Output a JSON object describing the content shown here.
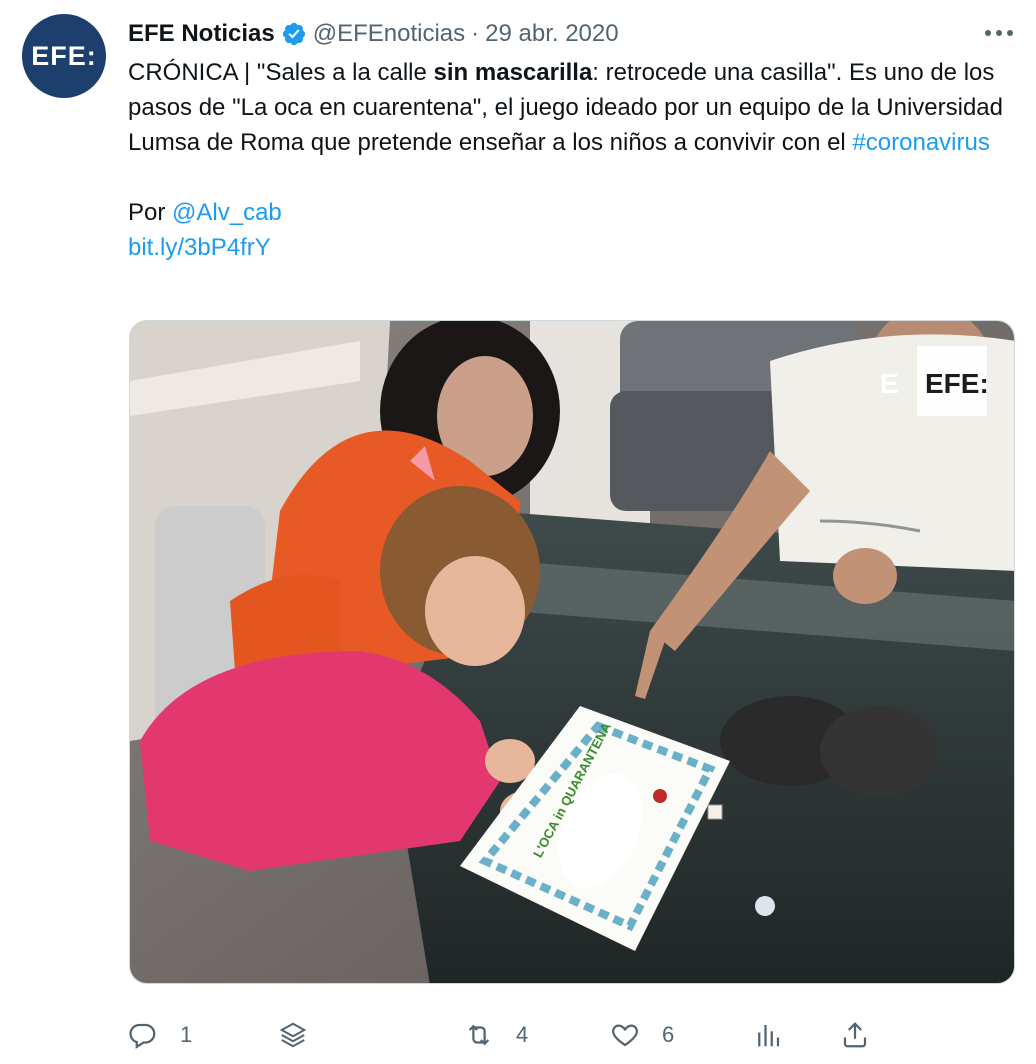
{
  "tweet": {
    "avatar_logo": "EFE:",
    "author_name": "EFE Noticias",
    "handle": "@EFEnoticias",
    "separator": "·",
    "date": "29 abr. 2020",
    "text": {
      "p1_a": "CRÓNICA | \"Sales a la calle ",
      "p1_bold": "sin mascarilla",
      "p1_b": ": retrocede una casilla\". Es uno de los pasos de \"La oca en cuarentena\", el juego ideado por un equipo de la Universidad Lumsa de Roma que pretende enseñar a los niños a convivir con el ",
      "hashtag": "#coronavirus",
      "by_label": "Por ",
      "mention": "@Alv_cab",
      "link": "bit.ly/3bP4frY"
    },
    "media": {
      "watermark": "EFE:",
      "board_title": "L'OCA in QUARANTENA"
    },
    "actions": {
      "reply_count": "1",
      "retweet_count": "4",
      "like_count": "6"
    }
  },
  "colors": {
    "accent": "#1d9bf0",
    "secondary_text": "#536471",
    "avatar_bg": "#1c3f6e"
  }
}
